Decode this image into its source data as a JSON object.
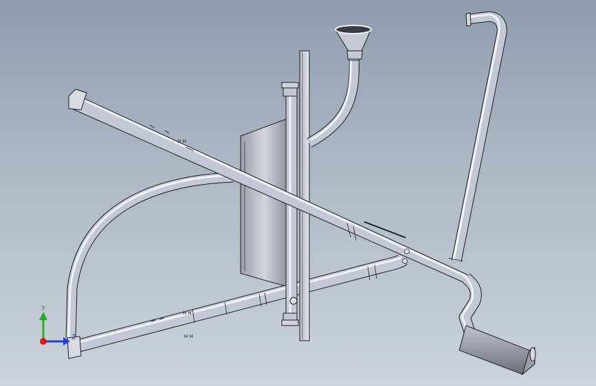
{
  "viewport": {
    "background_top": "#8e9cae",
    "background_bottom": "#ccd3dc",
    "tube_color": "#c4c7d6",
    "tube_highlight": "#f2f3f8",
    "tube_outline": "#1c1c1c"
  },
  "triad": {
    "y_label": "Y",
    "z_label": "Z",
    "x_color": "#1f3fd6",
    "y_color": "#22b022",
    "origin_color": "#d61f1f"
  }
}
